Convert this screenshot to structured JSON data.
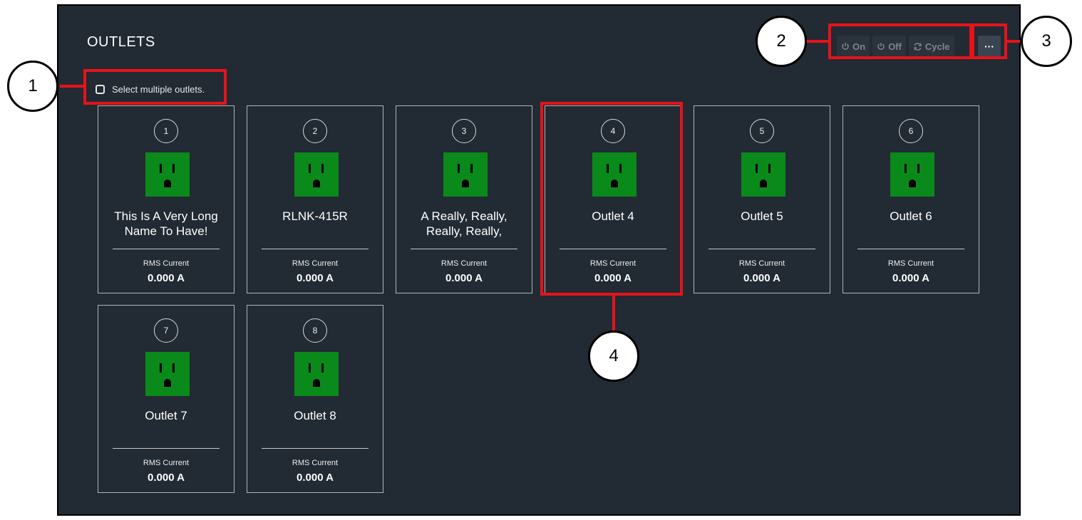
{
  "panel": {
    "title": "OUTLETS",
    "select_multiple_label": "Select multiple outlets.",
    "toolbar": {
      "on": "On",
      "off": "Off",
      "cycle": "Cycle",
      "more": "···"
    }
  },
  "outlets": [
    {
      "number": "1",
      "name": "This Is A Very Long Name To Have!",
      "metric_label": "RMS Current",
      "value": "0.000 A"
    },
    {
      "number": "2",
      "name": "RLNK-415R",
      "metric_label": "RMS Current",
      "value": "0.000 A"
    },
    {
      "number": "3",
      "name": "A Really, Really, Really, Really,",
      "metric_label": "RMS Current",
      "value": "0.000 A"
    },
    {
      "number": "4",
      "name": "Outlet 4",
      "metric_label": "RMS Current",
      "value": "0.000 A"
    },
    {
      "number": "5",
      "name": "Outlet 5",
      "metric_label": "RMS Current",
      "value": "0.000 A"
    },
    {
      "number": "6",
      "name": "Outlet 6",
      "metric_label": "RMS Current",
      "value": "0.000 A"
    },
    {
      "number": "7",
      "name": "Outlet 7",
      "metric_label": "RMS Current",
      "value": "0.000 A"
    },
    {
      "number": "8",
      "name": "Outlet 8",
      "metric_label": "RMS Current",
      "value": "0.000 A"
    }
  ],
  "callouts": [
    "1",
    "2",
    "3",
    "4"
  ],
  "colors": {
    "panel_bg": "#222a33",
    "outlet_on": "#0a8a1a",
    "highlight": "#e8121a"
  }
}
